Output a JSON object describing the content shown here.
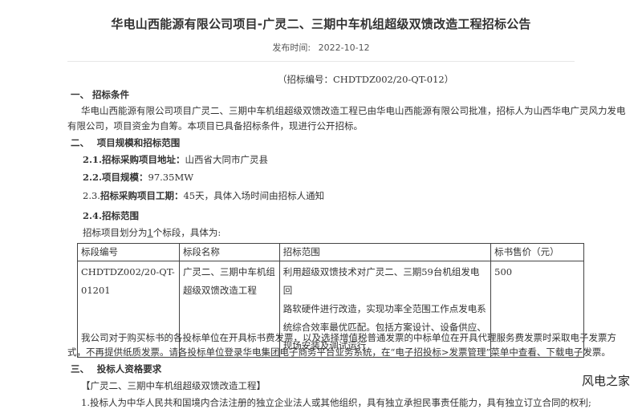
{
  "header": {
    "title": "华电山西能源有限公司项目-广灵二、三期中车机组超级双馈改造工程招标公告",
    "date_label": "发布时间:",
    "date_value": "2022-10-12"
  },
  "body": {
    "bid_number": "（招标编号：CHDTDZ002/20-QT-012）",
    "s1_heading": "一、 招标条件",
    "s1_p1": "华电山西能源有限公司项目广灵二、三期中车机组超级双馈改造工程已由华电山西能源有限公司批准，招标人为山西华电广灵风力发电",
    "s1_p2": "有限公司，项目资金为自筹。本项目已具备招标条件，现进行公开招标。",
    "s2_heading": "二、　 项目规模和招标范围",
    "item21_label": "2.1.招标采购项目地址：",
    "item21_value": "山西省大同市广灵县",
    "item22_label": "2.2.项目规模：",
    "item22_value": "97.35MW",
    "item23_prefix": "2.3.",
    "item23_label": "招标采购项目工期：",
    "item23_value": "45天，具体入场时间由招标人通知",
    "item24_label": "2.4.招标范围",
    "lots_prefix": "招标项目划分为",
    "lots_count": "1",
    "lots_suffix": "个标段，具体为:",
    "invoice_p1": "我公司对于购买标书的各投标单位在开具标书费发票，以及选择增值税普通发票的中标单位在开具代理服务费发票时采取电子发票方",
    "invoice_p2": "式，不再提供纸质发票。请各投标单位登录华电集团电子商务平台业务系统，在“电子招投标>发票管理”菜单中查看、下载电子发票。",
    "s3_heading": "三、　 投标人资格要求",
    "s3_sub": "【广灵二、三期中车机组超级双馈改造工程】",
    "s3_item1": "1.投标人为中华人民共和国境内合法注册的独立企业法人或其他组织，具有独立承担民事责任能力，具有独立订立合同的权利;"
  },
  "table": {
    "headers": [
      "标段编号",
      "标段名称",
      "招标范围",
      "标书售价（元）"
    ],
    "row": {
      "code_lines": [
        "CHDTDZ002/20-QT-",
        "01201"
      ],
      "name_lines": [
        "广灵二、三期中车机组",
        "超级双馈改造工程"
      ],
      "scope_lines": [
        "利用超级双馈技术对广灵二、三期59台机组发电回",
        "路软硬件进行改造，实现功率全范围工作点发电系",
        "统综合效率最优匹配。包括方案设计、设备供应、",
        "现场安装及调试运行"
      ],
      "price": "500"
    }
  },
  "watermark": {
    "text": "风电之家"
  }
}
